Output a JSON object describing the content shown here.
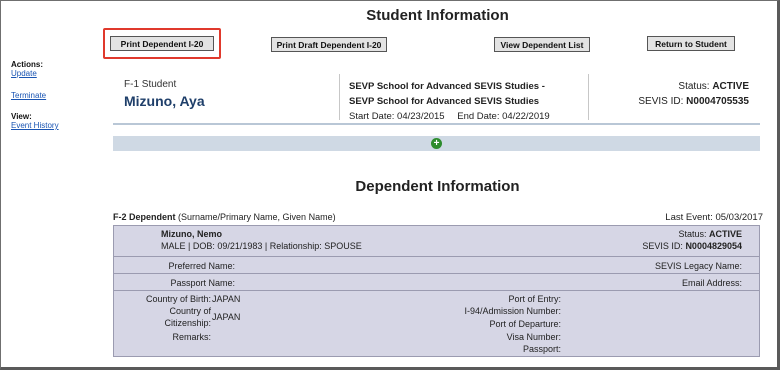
{
  "page": {
    "title": "Student Information"
  },
  "toolbar": {
    "print_dependent_i20": "Print Dependent I-20",
    "print_draft_dependent_i20": "Print Draft Dependent I-20",
    "view_dependent_list": "View Dependent List",
    "return_to_student": "Return to Student"
  },
  "sidebar": {
    "actions_label": "Actions:",
    "update": "Update",
    "terminate": "Terminate",
    "view_label": "View:",
    "event_history": "Event History"
  },
  "student": {
    "type": "F-1 Student",
    "name": "Mizuno, Aya",
    "school_line1": "SEVP School for Advanced SEVIS Studies -",
    "school_line2": "SEVP School for Advanced SEVIS Studies",
    "start_date": "Start Date: 04/23/2015",
    "end_date": "End Date: 04/22/2019",
    "status_label": "Status:",
    "status_value": "ACTIVE",
    "sevis_label": "SEVIS ID:",
    "sevis_value": "N0004705535"
  },
  "dependent_section": {
    "title": "Dependent Information",
    "f2_label": "F-2 Dependent",
    "f2_hint": "(Surname/Primary Name, Given Name)",
    "last_event": "Last Event: 05/03/2017"
  },
  "dependent": {
    "name": "Mizuno, Nemo",
    "details": "MALE | DOB: 09/21/1983 | Relationship: SPOUSE",
    "status_label": "Status:",
    "status_value": "ACTIVE",
    "sevis_label": "SEVIS ID:",
    "sevis_value": "N0004829054",
    "preferred_name_label": "Preferred Name:",
    "sevis_legacy_label": "SEVIS Legacy Name:",
    "passport_name_label": "Passport Name:",
    "email_label": "Email Address:",
    "birth_country_label": "Country of Birth:",
    "birth_country_value": "JAPAN",
    "citizenship_label_1": "Country of",
    "citizenship_label_2": "Citizenship:",
    "citizenship_value": "JAPAN",
    "remarks_label": "Remarks:",
    "port_of_entry_label": "Port of Entry:",
    "i94_label": "I-94/Admission Number:",
    "port_of_departure_label": "Port of Departure:",
    "visa_number_label": "Visa Number:",
    "passport_label": "Passport:"
  },
  "colors": {
    "highlight": "#e0392c",
    "link": "#1a55b3",
    "name": "#1f3f6a",
    "dependent_bg": "#d6d6e5",
    "expander_bg": "#cfd9e4",
    "plus_icon": "#2d8c2d"
  }
}
